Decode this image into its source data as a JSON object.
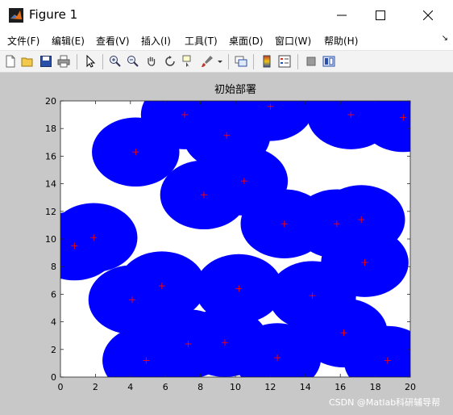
{
  "window": {
    "title": "Figure 1",
    "controls": {
      "minimize": "—",
      "maximize": "☐",
      "close": "✕"
    }
  },
  "menu": {
    "items": [
      "文件(F)",
      "编辑(E)",
      "查看(V)",
      "插入(I)",
      "工具(T)",
      "桌面(D)",
      "窗口(W)",
      "帮助(H)"
    ]
  },
  "toolbar": {
    "icons": [
      "new-figure-icon",
      "open-icon",
      "save-icon",
      "print-icon",
      "pointer-icon",
      "zoom-in-icon",
      "zoom-out-icon",
      "pan-icon",
      "rotate-3d-icon",
      "data-cursor-icon",
      "brush-icon",
      "brush-dropdown-icon",
      "link-plot-icon",
      "colorbar-icon",
      "legend-icon",
      "hide-plot-tools-icon",
      "show-plot-tools-icon"
    ]
  },
  "colors": {
    "circle": "#0000ff",
    "marker": "#ff0000",
    "axes_bg": "#ffffff",
    "figure_bg": "#c8c8c8"
  },
  "watermark": "CSDN @Matlab科研辅导帮",
  "chart_data": {
    "type": "scatter",
    "title": "初始部署",
    "xlabel": "",
    "ylabel": "",
    "xlim": [
      0,
      20
    ],
    "ylim": [
      0,
      20
    ],
    "xticks": [
      "0",
      "2",
      "4",
      "6",
      "8",
      "10",
      "12",
      "14",
      "16",
      "18",
      "20"
    ],
    "yticks": [
      "0",
      "2",
      "4",
      "6",
      "8",
      "10",
      "12",
      "14",
      "16",
      "18",
      "20"
    ],
    "grid": false,
    "coverage_radius": 2.5,
    "marker": "+",
    "points": [
      {
        "x": 0.8,
        "y": 9.5
      },
      {
        "x": 1.9,
        "y": 10.1
      },
      {
        "x": 4.3,
        "y": 16.3
      },
      {
        "x": 7.1,
        "y": 19.0
      },
      {
        "x": 9.5,
        "y": 17.5
      },
      {
        "x": 12.0,
        "y": 19.6
      },
      {
        "x": 16.6,
        "y": 19.0
      },
      {
        "x": 19.6,
        "y": 18.8
      },
      {
        "x": 8.2,
        "y": 13.2
      },
      {
        "x": 10.5,
        "y": 14.2
      },
      {
        "x": 12.8,
        "y": 11.1
      },
      {
        "x": 15.8,
        "y": 11.1
      },
      {
        "x": 17.2,
        "y": 11.4
      },
      {
        "x": 17.4,
        "y": 8.3
      },
      {
        "x": 14.4,
        "y": 5.9
      },
      {
        "x": 10.2,
        "y": 6.4
      },
      {
        "x": 5.8,
        "y": 6.6
      },
      {
        "x": 4.1,
        "y": 5.6
      },
      {
        "x": 16.2,
        "y": 3.2
      },
      {
        "x": 18.7,
        "y": 1.2
      },
      {
        "x": 12.4,
        "y": 1.4
      },
      {
        "x": 9.4,
        "y": 2.5
      },
      {
        "x": 7.3,
        "y": 2.4
      },
      {
        "x": 4.9,
        "y": 1.2
      }
    ]
  }
}
